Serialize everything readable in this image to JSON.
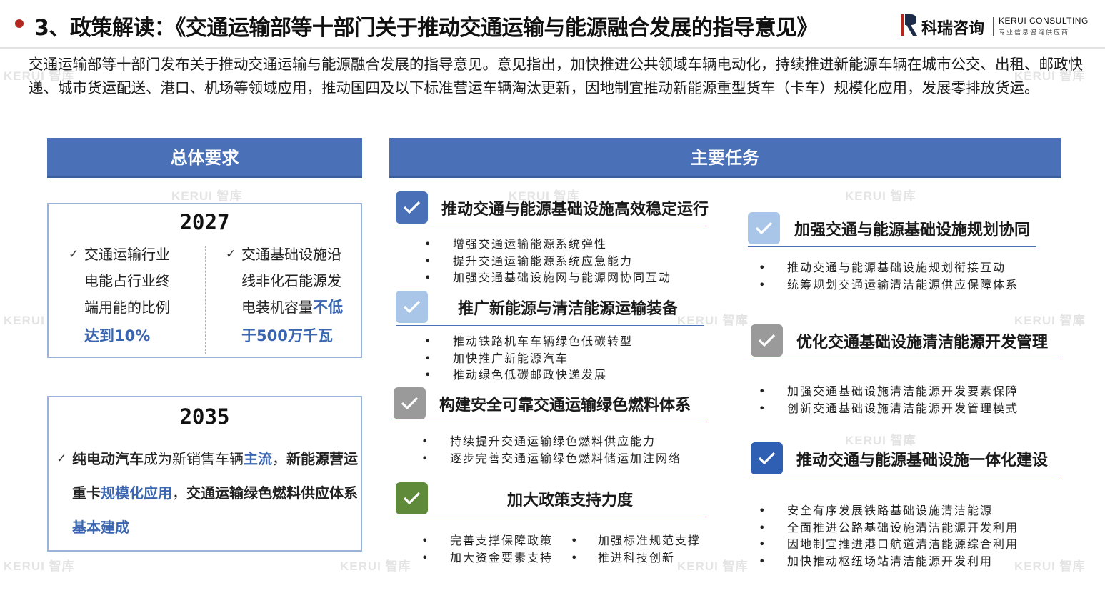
{
  "header": {
    "title": "3、政策解读：《交通运输部等十部门关于推动交通运输与能源融合发展的指导意见》",
    "logo_cn": "科瑞咨询",
    "logo_en": "KERUI CONSULTING",
    "logo_sub": "专业信息咨询供应商"
  },
  "intro": "交通运输部等十部门发布关于推动交通运输与能源融合发展的指导意见。意见指出，加快推进公共领域车辆电动化，持续推进新能源车辆在城市公交、出租、邮政快递、城市货运配送、港口、机场等领域应用，推动国四及以下标准营运车辆淘汰更新，因地制宜推动新能源重型货车（卡车）规模化应用，发展零排放货运。",
  "watermark": "KERUI 智库",
  "left": {
    "title": "总体要求",
    "y2027": {
      "year": "2027",
      "col1": {
        "tick": "✓",
        "line1": "交通运输行业",
        "line2": "电能占行业终",
        "line3": "端用能的比例",
        "hl": "达到10%"
      },
      "col2": {
        "tick": "✓",
        "line1": "交通基础设施沿",
        "line2": "线非化石能源发",
        "line3a": "电装机容量",
        "hl1": "不低",
        "hl2": "于500万千瓦"
      }
    },
    "y2035": {
      "year": "2035",
      "tick": "✓",
      "p1": "纯电动汽车",
      "p2": "成为新销售车辆",
      "p3": "主流",
      "p4": "，",
      "p5": "新能源营运重卡",
      "p6": "规模化应用",
      "p7": "，",
      "p8": "交通运输绿色燃料供应体系",
      "p9": "基本建成"
    }
  },
  "right": {
    "title": "主要任务",
    "tasks": [
      {
        "title": "推动交通与能源基础设施高效稳定运行",
        "items": [
          "增强交通运输能源系统弹性",
          "提升交通运输能源系统应急能力",
          "加强交通基础设施网与能源网协同互动"
        ]
      },
      {
        "title": "推广新能源与清洁能源运输装备",
        "items": [
          "推动铁路机车车辆绿色低碳转型",
          "加快推广新能源汽车",
          "推动绿色低碳邮政快递发展"
        ]
      },
      {
        "title": "构建安全可靠交通运输绿色燃料体系",
        "items": [
          "持续提升交通运输绿色燃料供应能力",
          "逐步完善交通运输绿色燃料储运加注网络"
        ]
      },
      {
        "title": "加大政策支持力度",
        "items": [
          "完善支撑保障政策",
          "加大资金要素支持",
          "加强标准规范支撑",
          "推进科技创新"
        ]
      },
      {
        "title": "加强交通与能源基础设施规划协同",
        "items": [
          "推动交通与能源基础设施规划衔接互动",
          "统筹规划交通运输清洁能源供应保障体系"
        ]
      },
      {
        "title": "优化交通基础设施清洁能源开发管理",
        "items": [
          "加强交通基础设施清洁能源开发要素保障",
          "创新交通基础设施清洁能源开发管理模式"
        ]
      },
      {
        "title": "推动交通与能源基础设施一体化建设",
        "items": [
          "安全有序发展铁路基础设施清洁能源",
          "全面推进公路基础设施清洁能源开发利用",
          "因地制宜推进港口航道清洁能源综合利用",
          "加快推动枢纽场站清洁能源开发利用"
        ]
      }
    ],
    "bullet": "•"
  },
  "colors": {
    "accent": "#4a70b8",
    "highlight": "#3a65b0",
    "check_blue": "#4a70b8",
    "check_light": "#a9c6e8",
    "check_gray": "#9a9a9a",
    "check_green": "#5f8a3a",
    "brand_red": "#b3261e"
  },
  "icons": {
    "check": "check-icon",
    "tick": "tick-icon"
  }
}
